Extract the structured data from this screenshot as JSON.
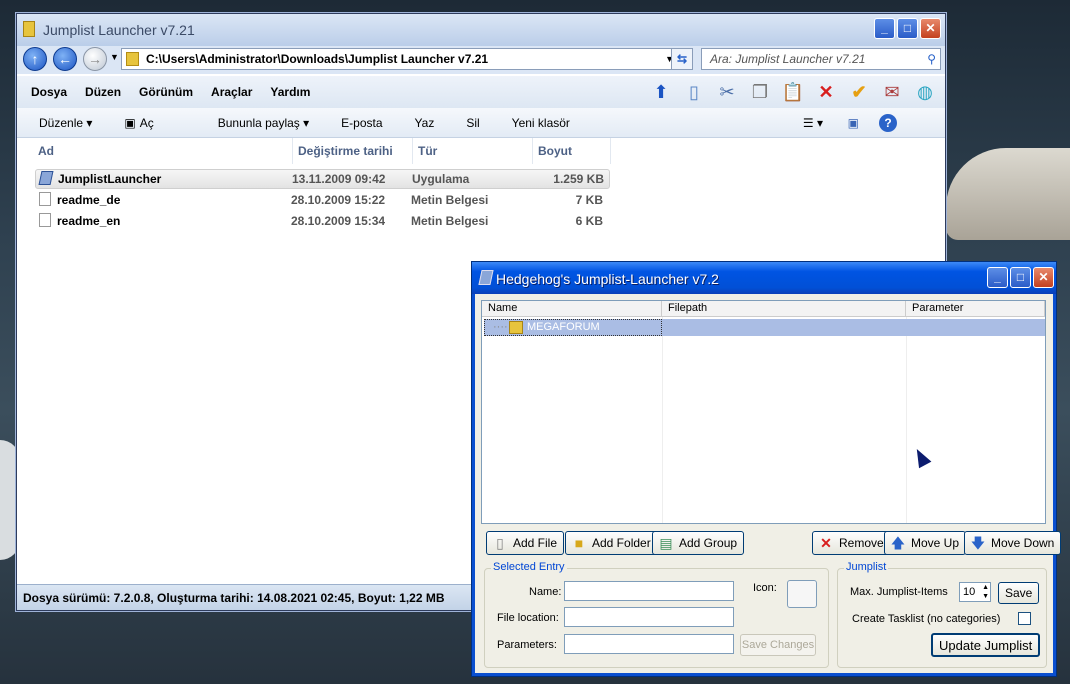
{
  "explorer": {
    "title": "Jumplist Launcher v7.21",
    "address": "C:\\Users\\Administrator\\Downloads\\Jumplist Launcher v7.21",
    "search_placeholder": "Ara: Jumplist Launcher v7.21",
    "menu": [
      "Dosya",
      "Düzen",
      "Görünüm",
      "Araçlar",
      "Yardım"
    ],
    "commands": [
      "Düzenle ▾",
      "Aç",
      "Bununla paylaş ▾",
      "E-posta",
      "Yaz",
      "Sil",
      "Yeni klasör"
    ],
    "columns": [
      "Ad",
      "Değiştirme tarihi",
      "Tür",
      "Boyut"
    ],
    "files": [
      {
        "name": "JumplistLauncher",
        "date": "13.11.2009 09:42",
        "type": "Uygulama",
        "size": "1.259 KB"
      },
      {
        "name": "readme_de",
        "date": "28.10.2009 15:22",
        "type": "Metin Belgesi",
        "size": "7 KB"
      },
      {
        "name": "readme_en",
        "date": "28.10.2009 15:34",
        "type": "Metin Belgesi",
        "size": "6 KB"
      }
    ],
    "status": "Dosya sürümü: 7.2.0.8, Oluşturma tarihi: 14.08.2021 02:45, Boyut: 1,22 MB"
  },
  "jumplist": {
    "title": "Hedgehog's Jumplist-Launcher v7.2",
    "columns": [
      "Name",
      "Filepath",
      "Parameter"
    ],
    "selected_item": "MEGAFORUM",
    "buttons": {
      "add_file": "Add File",
      "add_folder": "Add Folder",
      "add_group": "Add Group",
      "remove": "Remove",
      "move_up": "Move Up",
      "move_down": "Move Down",
      "save_changes": "Save Changes",
      "save": "Save",
      "update": "Update Jumplist"
    },
    "selected_entry": {
      "legend": "Selected Entry",
      "name_label": "Name:",
      "location_label": "File location:",
      "parameters_label": "Parameters:",
      "icon_label": "Icon:"
    },
    "jumplist_group": {
      "legend": "Jumplist",
      "max_label": "Max. Jumplist-Items",
      "max_value": "10",
      "tasklist_label": "Create Tasklist (no categories)"
    }
  },
  "colors": {
    "accent": "#0054e3",
    "explorer_title": "#dbe6f5"
  }
}
